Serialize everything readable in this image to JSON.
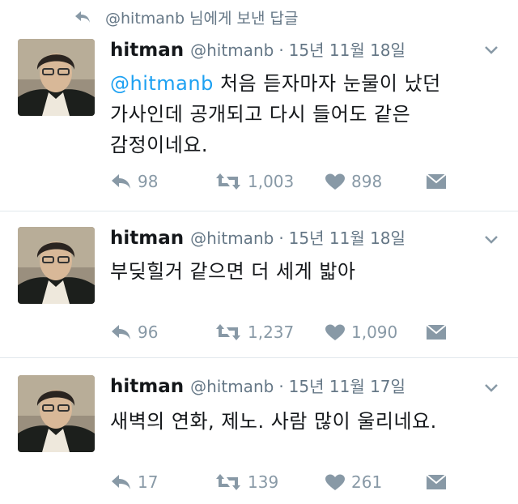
{
  "reply_context": {
    "text": "@hitmanb 님에게 보낸 답글"
  },
  "tweets": [
    {
      "name": "hitman",
      "handle": "@hitmanb",
      "date": "15년 11월 18일",
      "mention": "@hitmanb",
      "text_line1": " 처음 듣자마자 눈물이 났던",
      "text_line2": "가사인데 공개되고 다시 들어도 같은",
      "text_line3": "감정이네요.",
      "replies": "98",
      "retweets": "1,003",
      "likes": "898"
    },
    {
      "name": "hitman",
      "handle": "@hitmanb",
      "date": "15년 11월 18일",
      "text_line1": "부딪힐거 같으면 더 세게 밟아",
      "replies": "96",
      "retweets": "1,237",
      "likes": "1,090"
    },
    {
      "name": "hitman",
      "handle": "@hitmanb",
      "date": "15년 11월 17일",
      "text_line1": "새벽의 연화, 제노. 사람 많이 울리네요.",
      "replies": "17",
      "retweets": "139",
      "likes": "261"
    }
  ],
  "icons": {
    "reply": "reply-arrow-icon",
    "retweet": "retweet-icon",
    "like": "heart-icon",
    "dm": "envelope-icon",
    "caret": "chevron-down-icon"
  },
  "colors": {
    "mention": "#1da1f2",
    "meta": "#657786",
    "action": "#8899a6"
  }
}
